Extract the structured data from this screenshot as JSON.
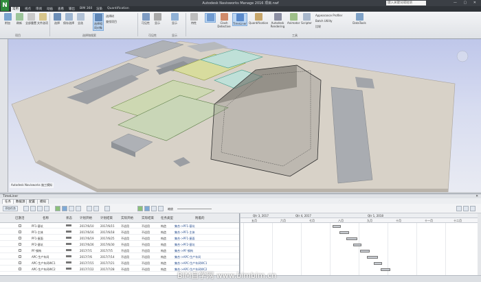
{
  "app": {
    "logo": "N",
    "title": "Autodesk Navisworks Manage 2016  项目.nwf",
    "search_placeholder": "键入关键词或短语",
    "window_controls": "— ▢ ✕"
  },
  "menu_tabs": [
    {
      "label": "常用",
      "active": true
    },
    {
      "label": "视点"
    },
    {
      "label": "审阅"
    },
    {
      "label": "动画"
    },
    {
      "label": "查看"
    },
    {
      "label": "输出"
    },
    {
      "label": "BIM 360"
    },
    {
      "label": "渲染"
    },
    {
      "label": "Quantification"
    }
  ],
  "ribbon": {
    "buttons": [
      {
        "label": "附加"
      },
      {
        "label": "刷新"
      },
      {
        "label": "全部重置"
      },
      {
        "label": "文件选项"
      },
      {
        "label": "选择"
      },
      {
        "label": "保存选择"
      },
      {
        "label": "全选"
      },
      {
        "label": "选择相同对象"
      },
      {
        "label": "选择树"
      },
      {
        "label": "查找项目"
      },
      {
        "label": "可见性"
      },
      {
        "label": "显示"
      },
      {
        "label": "特性"
      },
      {
        "label": "Clash Detective"
      },
      {
        "label": "TimeLiner"
      },
      {
        "label": "Quantification"
      },
      {
        "label": "Autodesk Rendering"
      },
      {
        "label": "Animator"
      },
      {
        "label": "Scripter"
      },
      {
        "label": "DataTools"
      }
    ],
    "side_items": [
      "Appearance Profiler",
      "Batch Utility",
      "比较"
    ],
    "groups": [
      "项目",
      "选择和搜索",
      "可见性",
      "显示",
      "工具"
    ]
  },
  "viewport": {
    "label": "Autodesk Navisworks 施工模拟"
  },
  "timeliner": {
    "title": "TimeLiner",
    "tabs": [
      {
        "label": "任务",
        "active": true
      },
      {
        "label": "数据源"
      },
      {
        "label": "配置"
      },
      {
        "label": "模拟"
      }
    ],
    "toolbar_add": "添加任务",
    "toolbar_zoom": "缩放",
    "columns": [
      "已激活",
      "名称",
      "状态",
      "计划开始",
      "计划结束",
      "实际开始",
      "实际结束",
      "任务类型",
      "附着的"
    ],
    "rows": [
      {
        "name": "PF1-基坑",
        "start": "2017/6/10",
        "end": "2017/6/15",
        "actual_start": "不适用",
        "actual_end": "不适用",
        "type": "构造",
        "attached": "集合->PF1-基坑"
      },
      {
        "name": "PF1-主体",
        "start": "2017/6/16",
        "end": "2017/6/18",
        "actual_start": "不适用",
        "actual_end": "不适用",
        "type": "构造",
        "attached": "集合->PF1-主体"
      },
      {
        "name": "PF1-屋面",
        "start": "2017/6/19",
        "end": "2017/6/25",
        "actual_start": "不适用",
        "actual_end": "不适用",
        "type": "构造",
        "attached": "集合->PF1-屋面"
      },
      {
        "name": "PF2-基坑",
        "start": "2017/6/26",
        "end": "2017/6/30",
        "actual_start": "不适用",
        "actual_end": "不适用",
        "type": "构造",
        "attached": "集合->PF2-基坑"
      },
      {
        "name": "PF-钢构",
        "start": "2017/7/1",
        "end": "2017/7/5",
        "actual_start": "不适用",
        "actual_end": "不适用",
        "type": "构造",
        "attached": "集合->PF-钢构"
      },
      {
        "name": "APC-生产车间",
        "start": "2017/7/6",
        "end": "2017/7/14",
        "actual_start": "不适用",
        "actual_end": "不适用",
        "type": "构造",
        "attached": "集合->APC-生产车间"
      },
      {
        "name": "APC-生产车间WC1",
        "start": "2017/7/15",
        "end": "2017/7/21",
        "actual_start": "不适用",
        "actual_end": "不适用",
        "type": "构造",
        "attached": "集合->APC-生产车间WC1"
      },
      {
        "name": "APC-生产车间WC2",
        "start": "2017/7/22",
        "end": "2017/7/28",
        "actual_start": "不适用",
        "actual_end": "不适用",
        "type": "构造",
        "attached": "集合->APC-生产车间WC2"
      }
    ],
    "gantt_quarters": [
      "Qtr 3, 2017",
      "Qtr 4, 2017",
      "Qtr 1, 2018"
    ],
    "gantt_months": [
      "五月",
      "六月",
      "七月",
      "八月",
      "九月",
      "十月",
      "十一月",
      "十二月"
    ]
  },
  "watermark": "BIM自学网 www.bimbim.cn"
}
